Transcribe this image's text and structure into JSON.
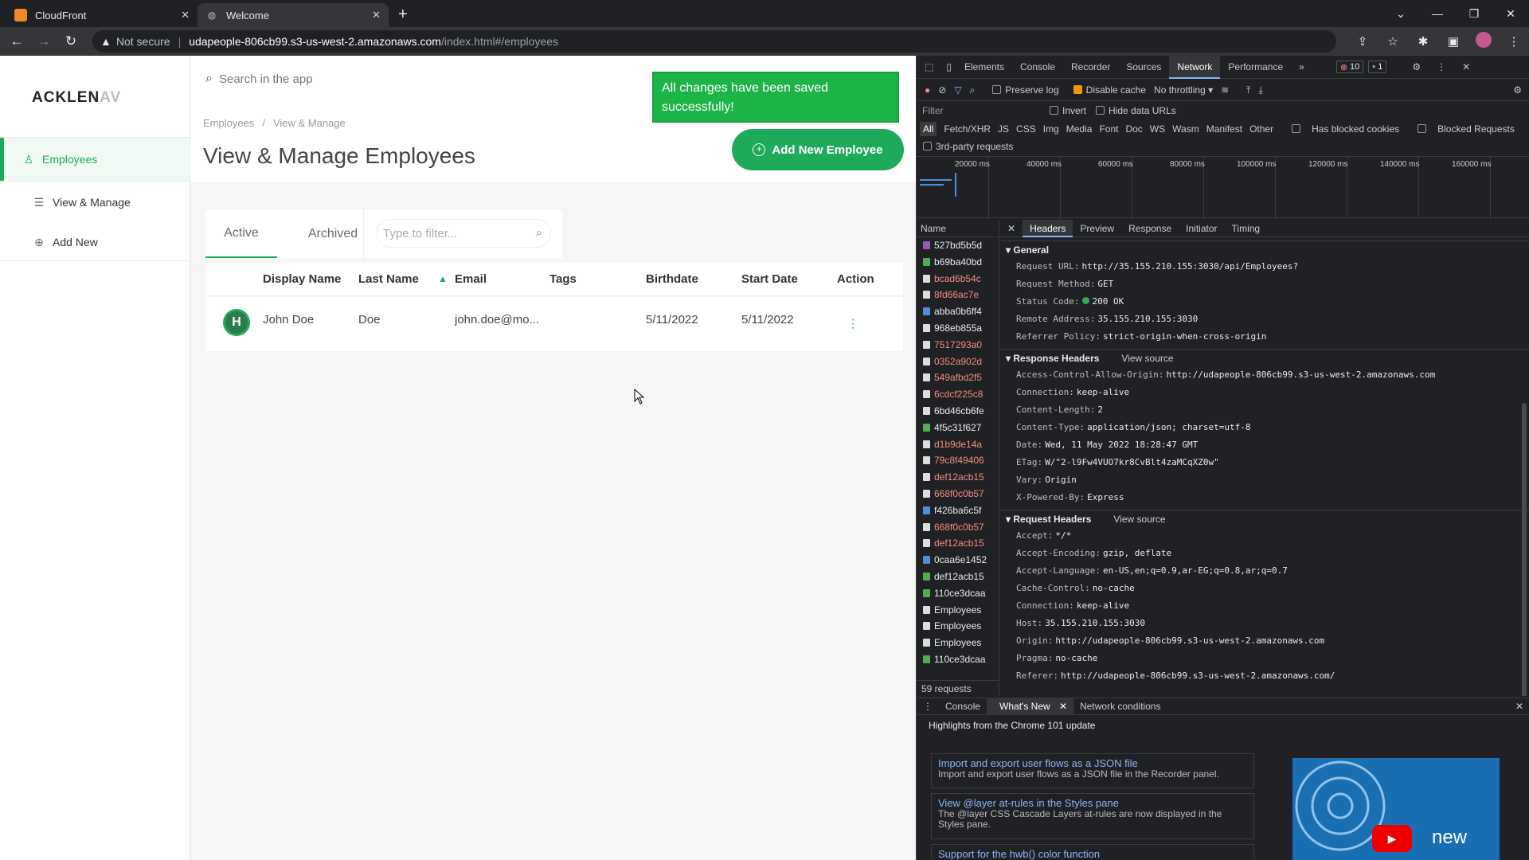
{
  "browser": {
    "tabs": [
      {
        "title": "CloudFront",
        "icon": "cloudfront-icon"
      },
      {
        "title": "Welcome",
        "icon": "globe-icon"
      }
    ],
    "not_secure": "Not secure",
    "url_host": "udapeople-806cb99.s3-us-west-2.amazonaws.com",
    "url_path": "/index.html#/employees"
  },
  "app": {
    "logo_main": "ACKLEN",
    "logo_fade": "AV",
    "sidebar": [
      {
        "label": "Employees",
        "icon": "user-icon"
      },
      {
        "label": "View & Manage",
        "icon": "list-icon"
      },
      {
        "label": "Add New",
        "icon": "plus-circle-icon"
      }
    ],
    "search_placeholder": "Search in the app",
    "breadcrumb": [
      "Employees",
      "View & Manage"
    ],
    "page_title": "View & Manage Employees",
    "toast": "All changes have been saved successfully!",
    "add_button": "Add New Employee",
    "tabs": [
      "Active",
      "Archived"
    ],
    "filter_placeholder": "Type to filter...",
    "columns": [
      "Display Name",
      "Last Name",
      "Email",
      "Tags",
      "Birthdate",
      "Start Date",
      "Action"
    ],
    "row": {
      "display_name": "John Doe",
      "last_name": "Doe",
      "email": "john.doe@mo...",
      "tags": "",
      "birthdate": "5/11/2022",
      "start_date": "5/11/2022"
    },
    "accent": "#1dab5b"
  },
  "devtools": {
    "tabs": [
      "Elements",
      "Console",
      "Recorder",
      "Sources",
      "Network",
      "Performance"
    ],
    "errors": "10",
    "messages": "1",
    "toolbar": {
      "preserve_log": "Preserve log",
      "disable_cache": "Disable cache",
      "throttle": "No throttling"
    },
    "filter_label": "Filter",
    "invert": "Invert",
    "hide_data_urls": "Hide data URLs",
    "types": [
      "All",
      "Fetch/XHR",
      "JS",
      "CSS",
      "Img",
      "Media",
      "Font",
      "Doc",
      "WS",
      "Wasm",
      "Manifest",
      "Other"
    ],
    "blocked_cookies": "Has blocked cookies",
    "blocked_requests": "Blocked Requests",
    "third_party": "3rd-party requests",
    "timeline_ticks": [
      "20000 ms",
      "40000 ms",
      "60000 ms",
      "80000 ms",
      "100000 ms",
      "120000 ms",
      "140000 ms",
      "160000 ms"
    ],
    "name_header": "Name",
    "requests": [
      {
        "name": "527bd5b5d",
        "red": false
      },
      {
        "name": "b69ba40bd",
        "red": false
      },
      {
        "name": "bcad6b54c",
        "red": true
      },
      {
        "name": "8fd66ac7e",
        "red": true
      },
      {
        "name": "abba0b6ff4",
        "red": false
      },
      {
        "name": "968eb855a",
        "red": false
      },
      {
        "name": "7517293a0",
        "red": true
      },
      {
        "name": "0352a902d",
        "red": true
      },
      {
        "name": "549afbd2f5",
        "red": true
      },
      {
        "name": "6cdcf225c8",
        "red": true
      },
      {
        "name": "6bd46cb6fe",
        "red": false
      },
      {
        "name": "4f5c31f627",
        "red": false
      },
      {
        "name": "d1b9de14a",
        "red": true
      },
      {
        "name": "79c8f49406",
        "red": true
      },
      {
        "name": "def12acb15",
        "red": true
      },
      {
        "name": "668f0c0b57",
        "red": true
      },
      {
        "name": "f426ba6c5f",
        "red": false
      },
      {
        "name": "668f0c0b57",
        "red": true
      },
      {
        "name": "def12acb15",
        "red": true
      },
      {
        "name": "0caa6e1452",
        "red": false
      },
      {
        "name": "def12acb15",
        "red": false
      },
      {
        "name": "110ce3dcaa",
        "red": false
      },
      {
        "name": "Employees",
        "red": false
      },
      {
        "name": "Employees",
        "red": false
      },
      {
        "name": "Employees",
        "red": false
      },
      {
        "name": "110ce3dcaa",
        "red": false
      }
    ],
    "request_count": "59 requests",
    "detail_tabs": [
      "Headers",
      "Preview",
      "Response",
      "Initiator",
      "Timing"
    ],
    "general_title": "General",
    "general": [
      {
        "k": "Request URL:",
        "v": "http://35.155.210.155:3030/api/Employees?"
      },
      {
        "k": "Request Method:",
        "v": "GET"
      },
      {
        "k": "Status Code:",
        "v": "200 OK"
      },
      {
        "k": "Remote Address:",
        "v": "35.155.210.155:3030"
      },
      {
        "k": "Referrer Policy:",
        "v": "strict-origin-when-cross-origin"
      }
    ],
    "response_title": "Response Headers",
    "view_source": "View source",
    "response": [
      {
        "k": "Access-Control-Allow-Origin:",
        "v": "http://udapeople-806cb99.s3-us-west-2.amazonaws.com"
      },
      {
        "k": "Connection:",
        "v": "keep-alive"
      },
      {
        "k": "Content-Length:",
        "v": "2"
      },
      {
        "k": "Content-Type:",
        "v": "application/json; charset=utf-8"
      },
      {
        "k": "Date:",
        "v": "Wed, 11 May 2022 18:28:47 GMT"
      },
      {
        "k": "ETag:",
        "v": "W/\"2-l9Fw4VUO7kr8CvBlt4zaMCqXZ0w\""
      },
      {
        "k": "Vary:",
        "v": "Origin"
      },
      {
        "k": "X-Powered-By:",
        "v": "Express"
      }
    ],
    "request_title": "Request Headers",
    "request": [
      {
        "k": "Accept:",
        "v": "*/*"
      },
      {
        "k": "Accept-Encoding:",
        "v": "gzip, deflate"
      },
      {
        "k": "Accept-Language:",
        "v": "en-US,en;q=0.9,ar-EG;q=0.8,ar;q=0.7"
      },
      {
        "k": "Cache-Control:",
        "v": "no-cache"
      },
      {
        "k": "Connection:",
        "v": "keep-alive"
      },
      {
        "k": "Host:",
        "v": "35.155.210.155:3030"
      },
      {
        "k": "Origin:",
        "v": "http://udapeople-806cb99.s3-us-west-2.amazonaws.com"
      },
      {
        "k": "Pragma:",
        "v": "no-cache"
      },
      {
        "k": "Referer:",
        "v": "http://udapeople-806cb99.s3-us-west-2.amazonaws.com/"
      }
    ],
    "drawer_tabs": [
      "Console",
      "What's New",
      "Network conditions"
    ],
    "highlights": "Highlights from the Chrome 101 update",
    "whats_new": [
      {
        "title": "Import and export user flows as a JSON file",
        "desc": "Import and export user flows as a JSON file in the Recorder panel."
      },
      {
        "title": "View @layer at-rules in the Styles pane",
        "desc": "The @layer CSS Cascade Layers at-rules are now displayed in the Styles pane."
      },
      {
        "title": "Support for the hwb() color function",
        "desc": ""
      }
    ],
    "video_text": "new"
  }
}
